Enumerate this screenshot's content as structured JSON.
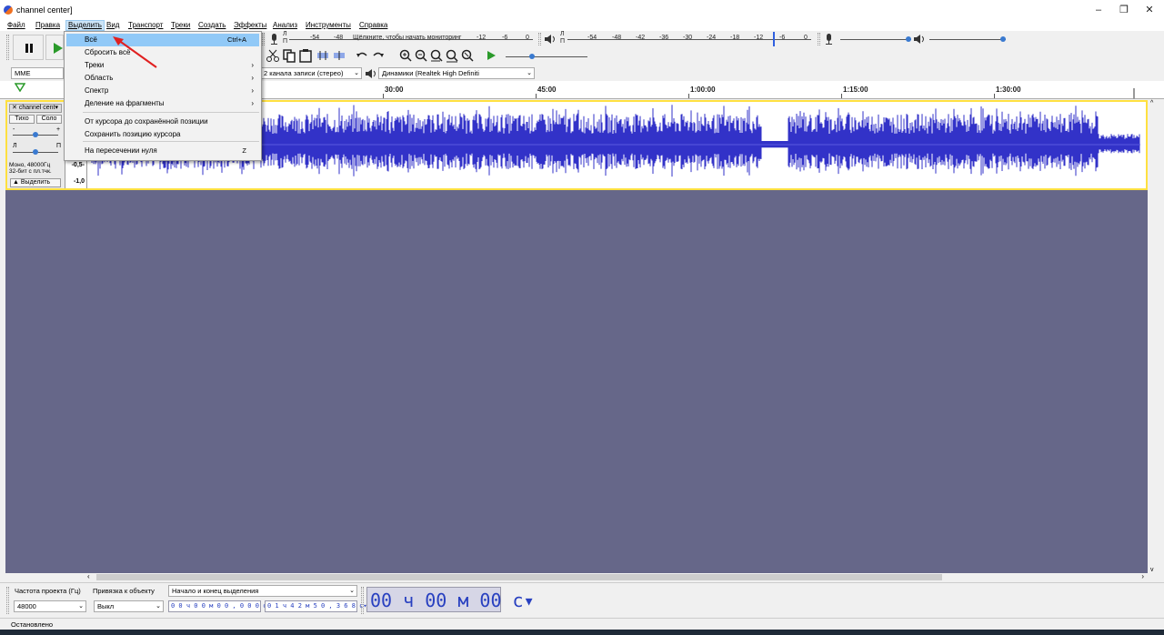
{
  "window": {
    "title": "channel center]",
    "controls": {
      "minimize": "–",
      "maximize": "❐",
      "close": "✕"
    }
  },
  "menubar": [
    "Файл",
    "Правка",
    "Выделить",
    "Вид",
    "Транспорт",
    "Треки",
    "Создать",
    "Эффекты",
    "Анализ",
    "Инструменты",
    "Справка"
  ],
  "active_menu": "Выделить",
  "select_menu": {
    "items": [
      {
        "label": "Всё",
        "shortcut": "Ctrl+A",
        "highlighted": true,
        "submenu": false
      },
      {
        "label": "Сбросить всё",
        "shortcut": "",
        "highlighted": false,
        "submenu": false
      },
      {
        "label": "Треки",
        "shortcut": "",
        "highlighted": false,
        "submenu": true
      },
      {
        "label": "Область",
        "shortcut": "",
        "highlighted": false,
        "submenu": true
      },
      {
        "label": "Спектр",
        "shortcut": "",
        "highlighted": false,
        "submenu": true
      },
      {
        "label": "Деление на фрагменты",
        "shortcut": "",
        "highlighted": false,
        "submenu": true
      },
      {
        "label": "От курсора до сохранённой позиции",
        "shortcut": "",
        "highlighted": false,
        "submenu": false
      },
      {
        "label": "Сохранить позицию курсора",
        "shortcut": "",
        "highlighted": false,
        "submenu": false
      },
      {
        "label": "На пересечении нуля",
        "shortcut": "Z",
        "highlighted": false,
        "submenu": false
      }
    ],
    "submenu_arrow": "›"
  },
  "toolbar": {
    "pause_icon": "pause-icon",
    "play_icon": "play-icon",
    "mic_meter": {
      "channel_top": "Л",
      "channel_bottom": "П",
      "scale": [
        "-54",
        "-48",
        "Щёлкните, чтобы начать мониторинг",
        "-12",
        "-6",
        "0"
      ]
    },
    "playback_meter": {
      "channel_top": "Л",
      "channel_bottom": "П",
      "scale": [
        "-54",
        "-48",
        "-42",
        "-36",
        "-30",
        "-24",
        "-18",
        "-12",
        "-6",
        "0"
      ]
    },
    "host": "MME",
    "record_channels": "2 канала записи (стерео)",
    "playback_device": "Динамики (Realtek High Definiti"
  },
  "ruler": {
    "ticks": [
      {
        "label": "30:00",
        "seconds": 1800
      },
      {
        "label": "45:00",
        "seconds": 2700
      },
      {
        "label": "1:00:00",
        "seconds": 3600
      },
      {
        "label": "1:15:00",
        "seconds": 4500
      },
      {
        "label": "1:30:00",
        "seconds": 5400
      }
    ]
  },
  "track": {
    "name": "channel cent▾",
    "close_icon": "✕",
    "mute": "Тихо",
    "solo": "Соло",
    "gain_minus": "-",
    "gain_plus": "+",
    "pan_left": "Л",
    "pan_right": "П",
    "info_line1": "Моно, 48000Гц",
    "info_line2": "32-бит с пл.тчк.",
    "select_button": "Выделить",
    "scale": [
      "-0,5-",
      "-1,0"
    ]
  },
  "selection_toolbar": {
    "project_rate_label": "Частота проекта (Гц)",
    "project_rate": "48000",
    "snap_label": "Привязка к объекту",
    "snap_value": "Выкл",
    "selection_mode": "Начало и конец выделения",
    "start_time": "0 0 ч 0 0 м 0 0 , 0 0 0 с▾",
    "end_time": "0 1 ч 4 2 м 5 0 , 3 6 8 с▾",
    "audio_position": "00 ч 00 м 00 с▾"
  },
  "status": "Остановлено",
  "colors": {
    "waveform": "#3232c8",
    "track_background": "#666789",
    "menu_highlight": "#91c9f7",
    "time_text": "#2840c0",
    "selection_border": "#ffe040",
    "annotation_arrow": "#e02020"
  }
}
